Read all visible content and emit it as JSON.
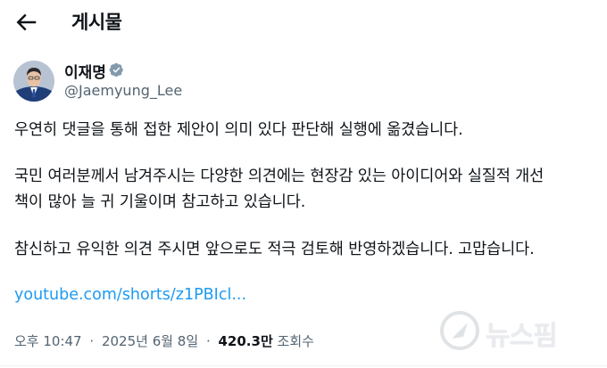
{
  "header": {
    "title": "게시물"
  },
  "author": {
    "name": "이재명",
    "handle": "@Jaemyung_Lee"
  },
  "tweet": {
    "lines": [
      "우연히 댓글을 통해 접한 제안이 의미 있다 판단해 실행에 옮겼습니다.",
      "국민 여러분께서 남겨주시는 다양한 의견에는 현장감 있는 아이디어와 실질적 개선",
      "책이 많아 늘 귀 기울이며 참고하고 있습니다.",
      "참신하고 유익한 의견 주시면 앞으로도 적극 검토해 반영하겠습니다. 고맙습니다."
    ],
    "link": "youtube.com/shorts/z1PBIcl..."
  },
  "meta": {
    "time": "오후 10:47",
    "date": "2025년 6월 8일",
    "separator": "·",
    "views_count": "420.3만",
    "views_label": "조회수"
  },
  "watermark": {
    "text": "뉴스핌"
  },
  "colors": {
    "link": "#1d9bf0",
    "muted": "#536471",
    "verified": "#829aab"
  },
  "icons": {
    "back": "arrow-left-icon",
    "verified": "verified-badge-icon"
  }
}
